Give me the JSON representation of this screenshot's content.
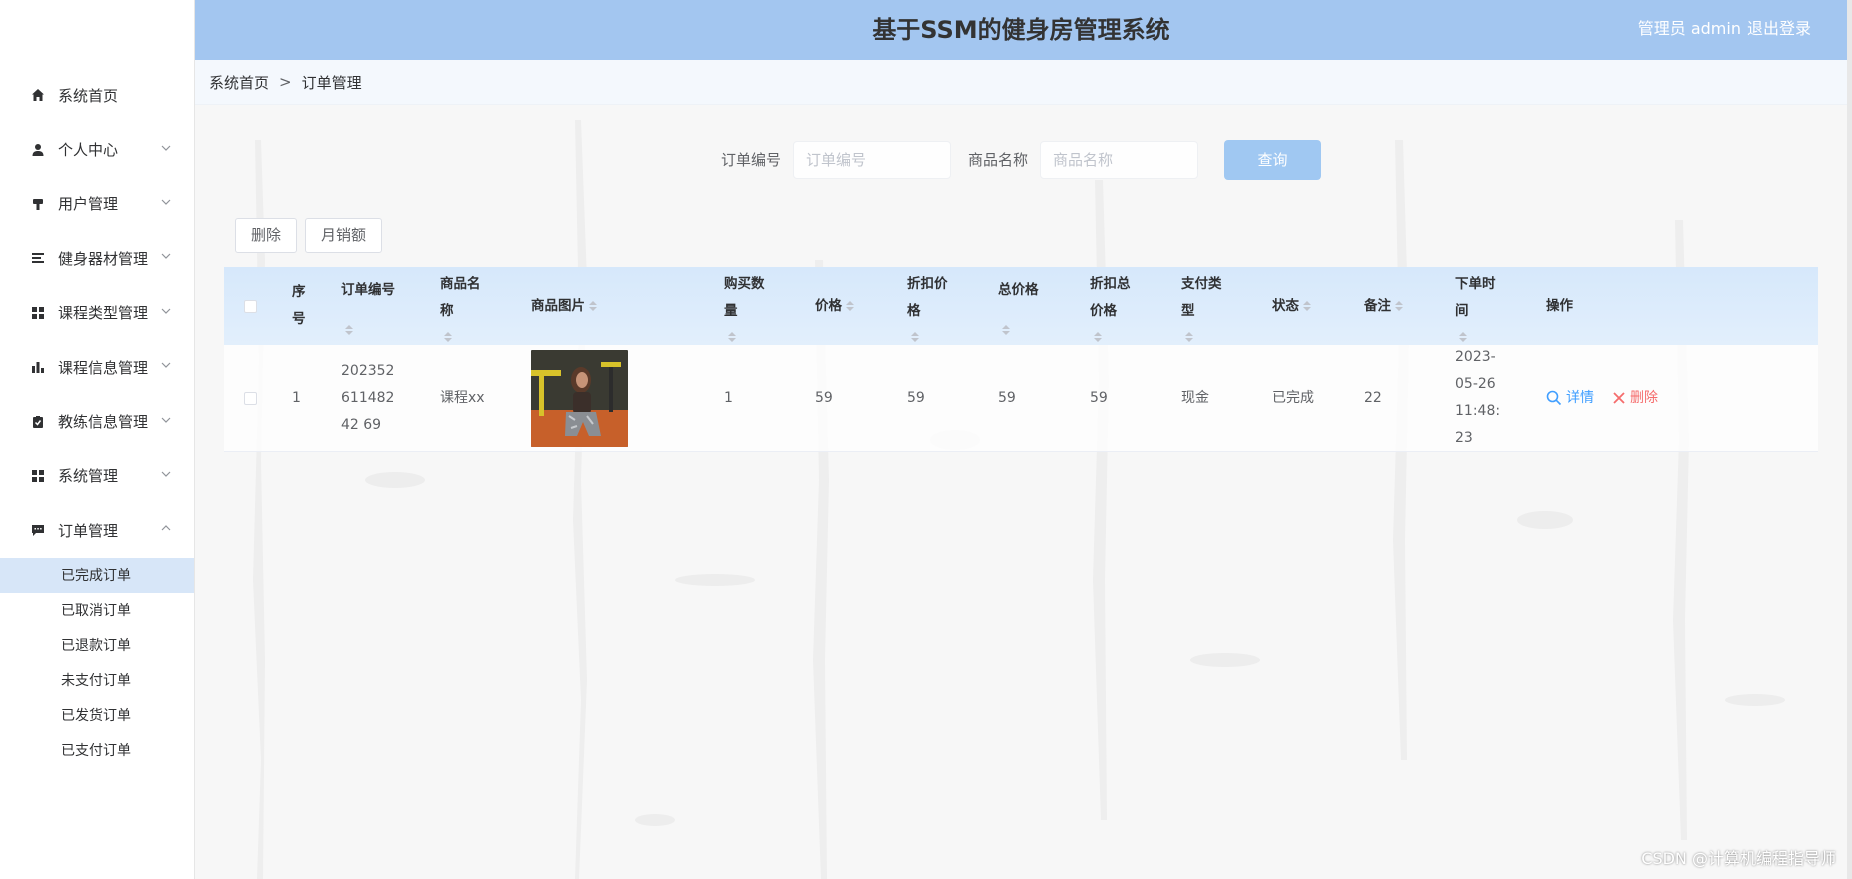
{
  "header": {
    "title": "基于SSM的健身房管理系统",
    "user_label": "管理员 admin",
    "logout": "退出登录"
  },
  "sidebar": {
    "items": [
      {
        "label": "系统首页",
        "icon": "home-icon"
      },
      {
        "label": "个人中心",
        "icon": "user-icon"
      },
      {
        "label": "用户管理",
        "icon": "stamp-icon"
      },
      {
        "label": "健身器材管理",
        "icon": "list-icon"
      },
      {
        "label": "课程类型管理",
        "icon": "grid-icon"
      },
      {
        "label": "课程信息管理",
        "icon": "bar-chart-icon"
      },
      {
        "label": "教练信息管理",
        "icon": "clipboard-check-icon"
      },
      {
        "label": "系统管理",
        "icon": "grid-icon"
      },
      {
        "label": "订单管理",
        "icon": "message-icon"
      }
    ],
    "order_sub": [
      {
        "label": "已完成订单",
        "active": true
      },
      {
        "label": "已取消订单"
      },
      {
        "label": "已退款订单"
      },
      {
        "label": "未支付订单"
      },
      {
        "label": "已发货订单"
      },
      {
        "label": "已支付订单"
      }
    ]
  },
  "breadcrumb": {
    "home": "系统首页",
    "sep": ">",
    "current": "订单管理"
  },
  "search": {
    "order_no_label": "订单编号",
    "order_no_placeholder": "订单编号",
    "product_label": "商品名称",
    "product_placeholder": "商品名称",
    "query_button": "查询"
  },
  "actions": {
    "delete": "删除",
    "monthly_sales": "月销额"
  },
  "table": {
    "headers": {
      "index": "序号",
      "order_no": "订单编号",
      "product_name": "商品名称",
      "product_image": "商品图片",
      "quantity": "购买数量",
      "price": "价格",
      "discount_price": "折扣价格",
      "total_price": "总价格",
      "discount_total": "折扣总价格",
      "pay_type": "支付类型",
      "status": "状态",
      "remark": "备注",
      "order_time": "下单时间",
      "ops": "操作"
    },
    "rows": [
      {
        "index": "1",
        "order_no": "20235261148242 69",
        "product_name": "课程xx",
        "quantity": "1",
        "price": "59",
        "discount_price": "59",
        "total_price": "59",
        "discount_total": "59",
        "pay_type": "现金",
        "status": "已完成",
        "remark": "22",
        "order_time": "2023-05-26 11:48:23",
        "detail": "详情",
        "delete": "删除"
      }
    ]
  },
  "watermark": "CSDN @计算机编程指导师",
  "colors": {
    "header": "#a3c6f0",
    "accent": "#409eff",
    "danger": "#f56c6c",
    "active_sub": "#d7e6f8"
  }
}
